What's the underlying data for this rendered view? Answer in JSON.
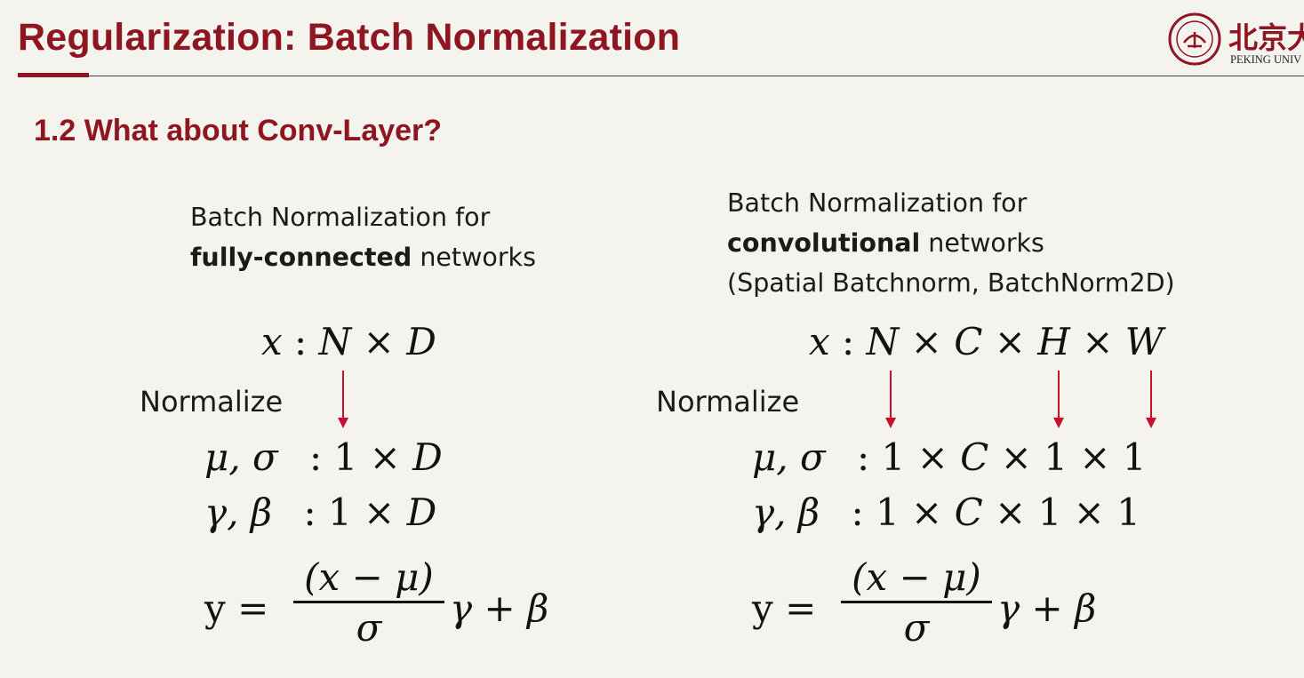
{
  "slide": {
    "title": "Regularization: Batch Normalization",
    "subtitle": "1.2 What about Conv-Layer?"
  },
  "logo": {
    "chinese": "北京大",
    "english": "PEKING UNIV"
  },
  "left": {
    "caption_line1": "Batch Normalization for",
    "caption_bold": "fully-connected",
    "caption_rest": " networks",
    "normalize_label": "Normalize",
    "input_var": "x",
    "input_shape_n": "N",
    "input_shape_d": "D",
    "mean_std_vars": "μ, σ",
    "mean_std_shape": ": 1 × ",
    "mean_std_shape_d": "D",
    "gamma_beta_vars": "γ, β",
    "gamma_beta_shape": ": 1 × ",
    "gamma_beta_shape_d": "D",
    "formula_lhs": "y =",
    "formula_numerator": "(x − μ)",
    "formula_denominator": "σ",
    "formula_rhs": "γ + β"
  },
  "right": {
    "caption_line1": "Batch Normalization for",
    "caption_bold": "convolutional",
    "caption_rest": " networks",
    "caption_line3": "(Spatial Batchnorm, BatchNorm2D)",
    "normalize_label": "Normalize",
    "input_var": "x",
    "input_shape_n": "N",
    "input_shape_c": "C",
    "input_shape_h": "H",
    "input_shape_w": "W",
    "mean_std_vars": "μ, σ",
    "mean_std_shape_pre": ": 1 × ",
    "mean_std_shape_c": "C",
    "mean_std_shape_post": " × 1 × 1",
    "gamma_beta_vars": "γ, β",
    "gamma_beta_shape_pre": ": 1 × ",
    "gamma_beta_shape_c": "C",
    "gamma_beta_shape_post": " × 1 × 1",
    "formula_lhs": "y =",
    "formula_numerator": "(x − μ)",
    "formula_denominator": "σ",
    "formula_rhs": "γ + β"
  },
  "colors": {
    "title": "#8e1620",
    "arrow": "#c8102e",
    "background": "#f4f3ee"
  }
}
